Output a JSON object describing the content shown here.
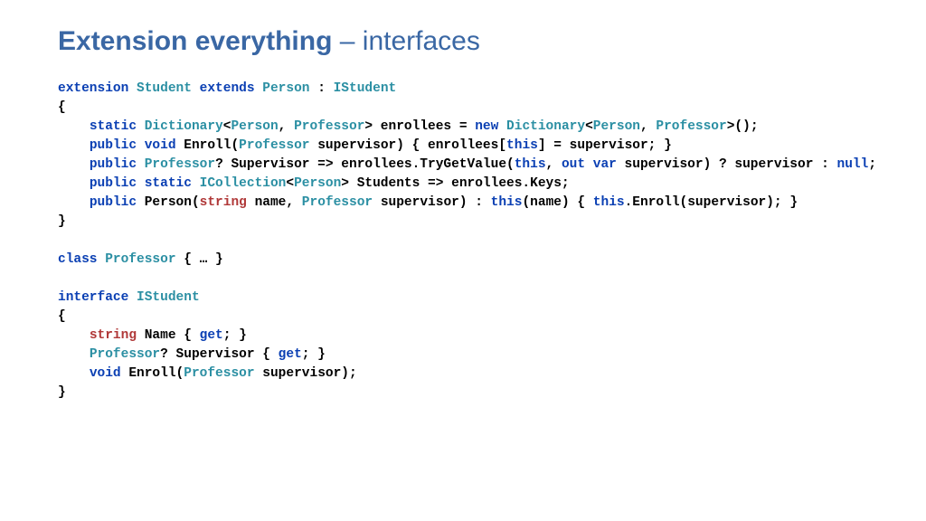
{
  "slide": {
    "title_strong": "Extension everything",
    "title_dash": " – ",
    "title_rest": "interfaces"
  },
  "code": {
    "tokens": [
      [
        [
          "kw",
          "extension"
        ],
        [
          "plain",
          " "
        ],
        [
          "typ",
          "Student"
        ],
        [
          "plain",
          " "
        ],
        [
          "kw",
          "extends"
        ],
        [
          "plain",
          " "
        ],
        [
          "typ",
          "Person"
        ],
        [
          "plain",
          " : "
        ],
        [
          "typ",
          "IStudent"
        ]
      ],
      [
        [
          "plain",
          "{"
        ]
      ],
      [
        [
          "plain",
          "    "
        ],
        [
          "kw",
          "static"
        ],
        [
          "plain",
          " "
        ],
        [
          "typ",
          "Dictionary"
        ],
        [
          "plain",
          "<"
        ],
        [
          "typ",
          "Person"
        ],
        [
          "plain",
          ", "
        ],
        [
          "typ",
          "Professor"
        ],
        [
          "plain",
          "> enrollees = "
        ],
        [
          "kw",
          "new"
        ],
        [
          "plain",
          " "
        ],
        [
          "typ",
          "Dictionary"
        ],
        [
          "plain",
          "<"
        ],
        [
          "typ",
          "Person"
        ],
        [
          "plain",
          ", "
        ],
        [
          "typ",
          "Professor"
        ],
        [
          "plain",
          ">();"
        ]
      ],
      [
        [
          "plain",
          "    "
        ],
        [
          "kw",
          "public"
        ],
        [
          "plain",
          " "
        ],
        [
          "kw",
          "void"
        ],
        [
          "plain",
          " Enroll("
        ],
        [
          "typ",
          "Professor"
        ],
        [
          "plain",
          " supervisor) { enrollees["
        ],
        [
          "kw",
          "this"
        ],
        [
          "plain",
          "] = supervisor; }"
        ]
      ],
      [
        [
          "plain",
          "    "
        ],
        [
          "kw",
          "public"
        ],
        [
          "plain",
          " "
        ],
        [
          "typ",
          "Professor"
        ],
        [
          "plain",
          "? Supervisor => enrollees.TryGetValue("
        ],
        [
          "kw",
          "this"
        ],
        [
          "plain",
          ", "
        ],
        [
          "kw",
          "out"
        ],
        [
          "plain",
          " "
        ],
        [
          "kw",
          "var"
        ],
        [
          "plain",
          " supervisor) ? supervisor : "
        ],
        [
          "kw",
          "null"
        ],
        [
          "plain",
          ";"
        ]
      ],
      [
        [
          "plain",
          "    "
        ],
        [
          "kw",
          "public"
        ],
        [
          "plain",
          " "
        ],
        [
          "kw",
          "static"
        ],
        [
          "plain",
          " "
        ],
        [
          "typ",
          "ICollection"
        ],
        [
          "plain",
          "<"
        ],
        [
          "typ",
          "Person"
        ],
        [
          "plain",
          "> Students => enrollees.Keys;"
        ]
      ],
      [
        [
          "plain",
          "    "
        ],
        [
          "kw",
          "public"
        ],
        [
          "plain",
          " Person("
        ],
        [
          "str",
          "string"
        ],
        [
          "plain",
          " name, "
        ],
        [
          "typ",
          "Professor"
        ],
        [
          "plain",
          " supervisor) : "
        ],
        [
          "kw",
          "this"
        ],
        [
          "plain",
          "(name) { "
        ],
        [
          "kw",
          "this"
        ],
        [
          "plain",
          ".Enroll(supervisor); }"
        ]
      ],
      [
        [
          "plain",
          "}"
        ]
      ],
      [
        [
          "plain",
          ""
        ]
      ],
      [
        [
          "kw",
          "class"
        ],
        [
          "plain",
          " "
        ],
        [
          "typ",
          "Professor"
        ],
        [
          "plain",
          " { … }"
        ]
      ],
      [
        [
          "plain",
          ""
        ]
      ],
      [
        [
          "kw",
          "interface"
        ],
        [
          "plain",
          " "
        ],
        [
          "typ",
          "IStudent"
        ]
      ],
      [
        [
          "plain",
          "{"
        ]
      ],
      [
        [
          "plain",
          "    "
        ],
        [
          "str",
          "string"
        ],
        [
          "plain",
          " Name { "
        ],
        [
          "kw",
          "get"
        ],
        [
          "plain",
          "; }"
        ]
      ],
      [
        [
          "plain",
          "    "
        ],
        [
          "typ",
          "Professor"
        ],
        [
          "plain",
          "? Supervisor { "
        ],
        [
          "kw",
          "get"
        ],
        [
          "plain",
          "; }"
        ]
      ],
      [
        [
          "plain",
          "    "
        ],
        [
          "kw",
          "void"
        ],
        [
          "plain",
          " Enroll("
        ],
        [
          "typ",
          "Professor"
        ],
        [
          "plain",
          " supervisor);"
        ]
      ],
      [
        [
          "plain",
          "}"
        ]
      ]
    ]
  }
}
